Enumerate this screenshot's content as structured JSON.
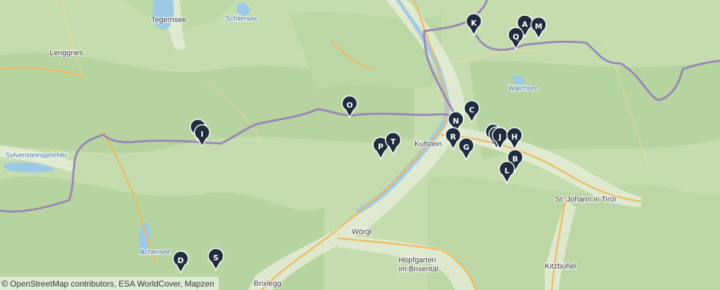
{
  "places": [
    {
      "name": "Tegernsee",
      "type": "town"
    },
    {
      "name": "Schliersee",
      "type": "water"
    },
    {
      "name": "Lenggries",
      "type": "town"
    },
    {
      "name": "Sylvensteinspeicher",
      "type": "water"
    },
    {
      "name": "Walchsee",
      "type": "water"
    },
    {
      "name": "Kufstein",
      "type": "town"
    },
    {
      "name": "St. Johann in Tirol",
      "type": "town"
    },
    {
      "name": "Wörgl",
      "type": "town"
    },
    {
      "name": "Achensee",
      "type": "water"
    },
    {
      "name": "Hopfgarten im Brixental",
      "type": "town"
    },
    {
      "name": "Kitzbühel",
      "type": "town"
    },
    {
      "name": "Brixlegg",
      "type": "town"
    }
  ],
  "markers": [
    "K",
    "A",
    "M",
    "Q",
    "O",
    "C",
    "N",
    "R",
    "G",
    "P",
    "T",
    "J",
    "H",
    "B",
    "L",
    "I",
    "D",
    "S"
  ],
  "attribution": {
    "copyright_symbol": "©",
    "text": "OpenStreetMap contributors, ESA WorldCover, Mapzen"
  },
  "colors": {
    "land": "#c5dcae",
    "forest": "#aacd95",
    "valley": "#e4ecd6",
    "water": "#9cc9e6",
    "border": "#9a86b5",
    "road_major": "#f0b85a",
    "marker": "#1f2d3d"
  }
}
